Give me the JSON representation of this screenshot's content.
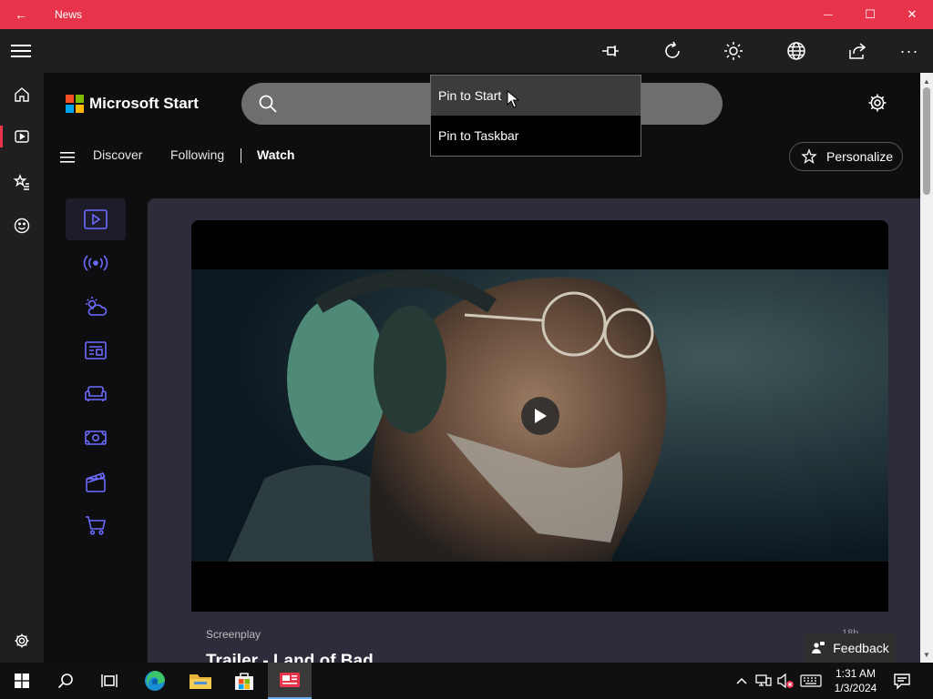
{
  "window": {
    "title": "News",
    "back_glyph": "←",
    "min_glyph": "—",
    "max_glyph": "☐",
    "close_glyph": "✕"
  },
  "toolbar": {
    "more_glyph": "···"
  },
  "brand": {
    "name": "Microsoft Start",
    "colors": [
      "#f25022",
      "#7fba00",
      "#00a4ef",
      "#ffb900"
    ]
  },
  "search": {
    "value": "",
    "placeholder": ""
  },
  "nav": {
    "discover": "Discover",
    "following": "Following",
    "watch": "Watch",
    "personalize": "Personalize"
  },
  "flyout": {
    "items": [
      "Pin to Start",
      "Pin to Taskbar"
    ]
  },
  "video": {
    "source": "Screenplay",
    "title": "Trailer - Land of Bad",
    "age": "18h"
  },
  "feedback": {
    "label": "Feedback"
  },
  "clock": {
    "time": "1:31 AM",
    "date": "1/3/2024"
  },
  "colors": {
    "titlebar": "#e8344a",
    "accent_icon": "#6b6cff"
  }
}
